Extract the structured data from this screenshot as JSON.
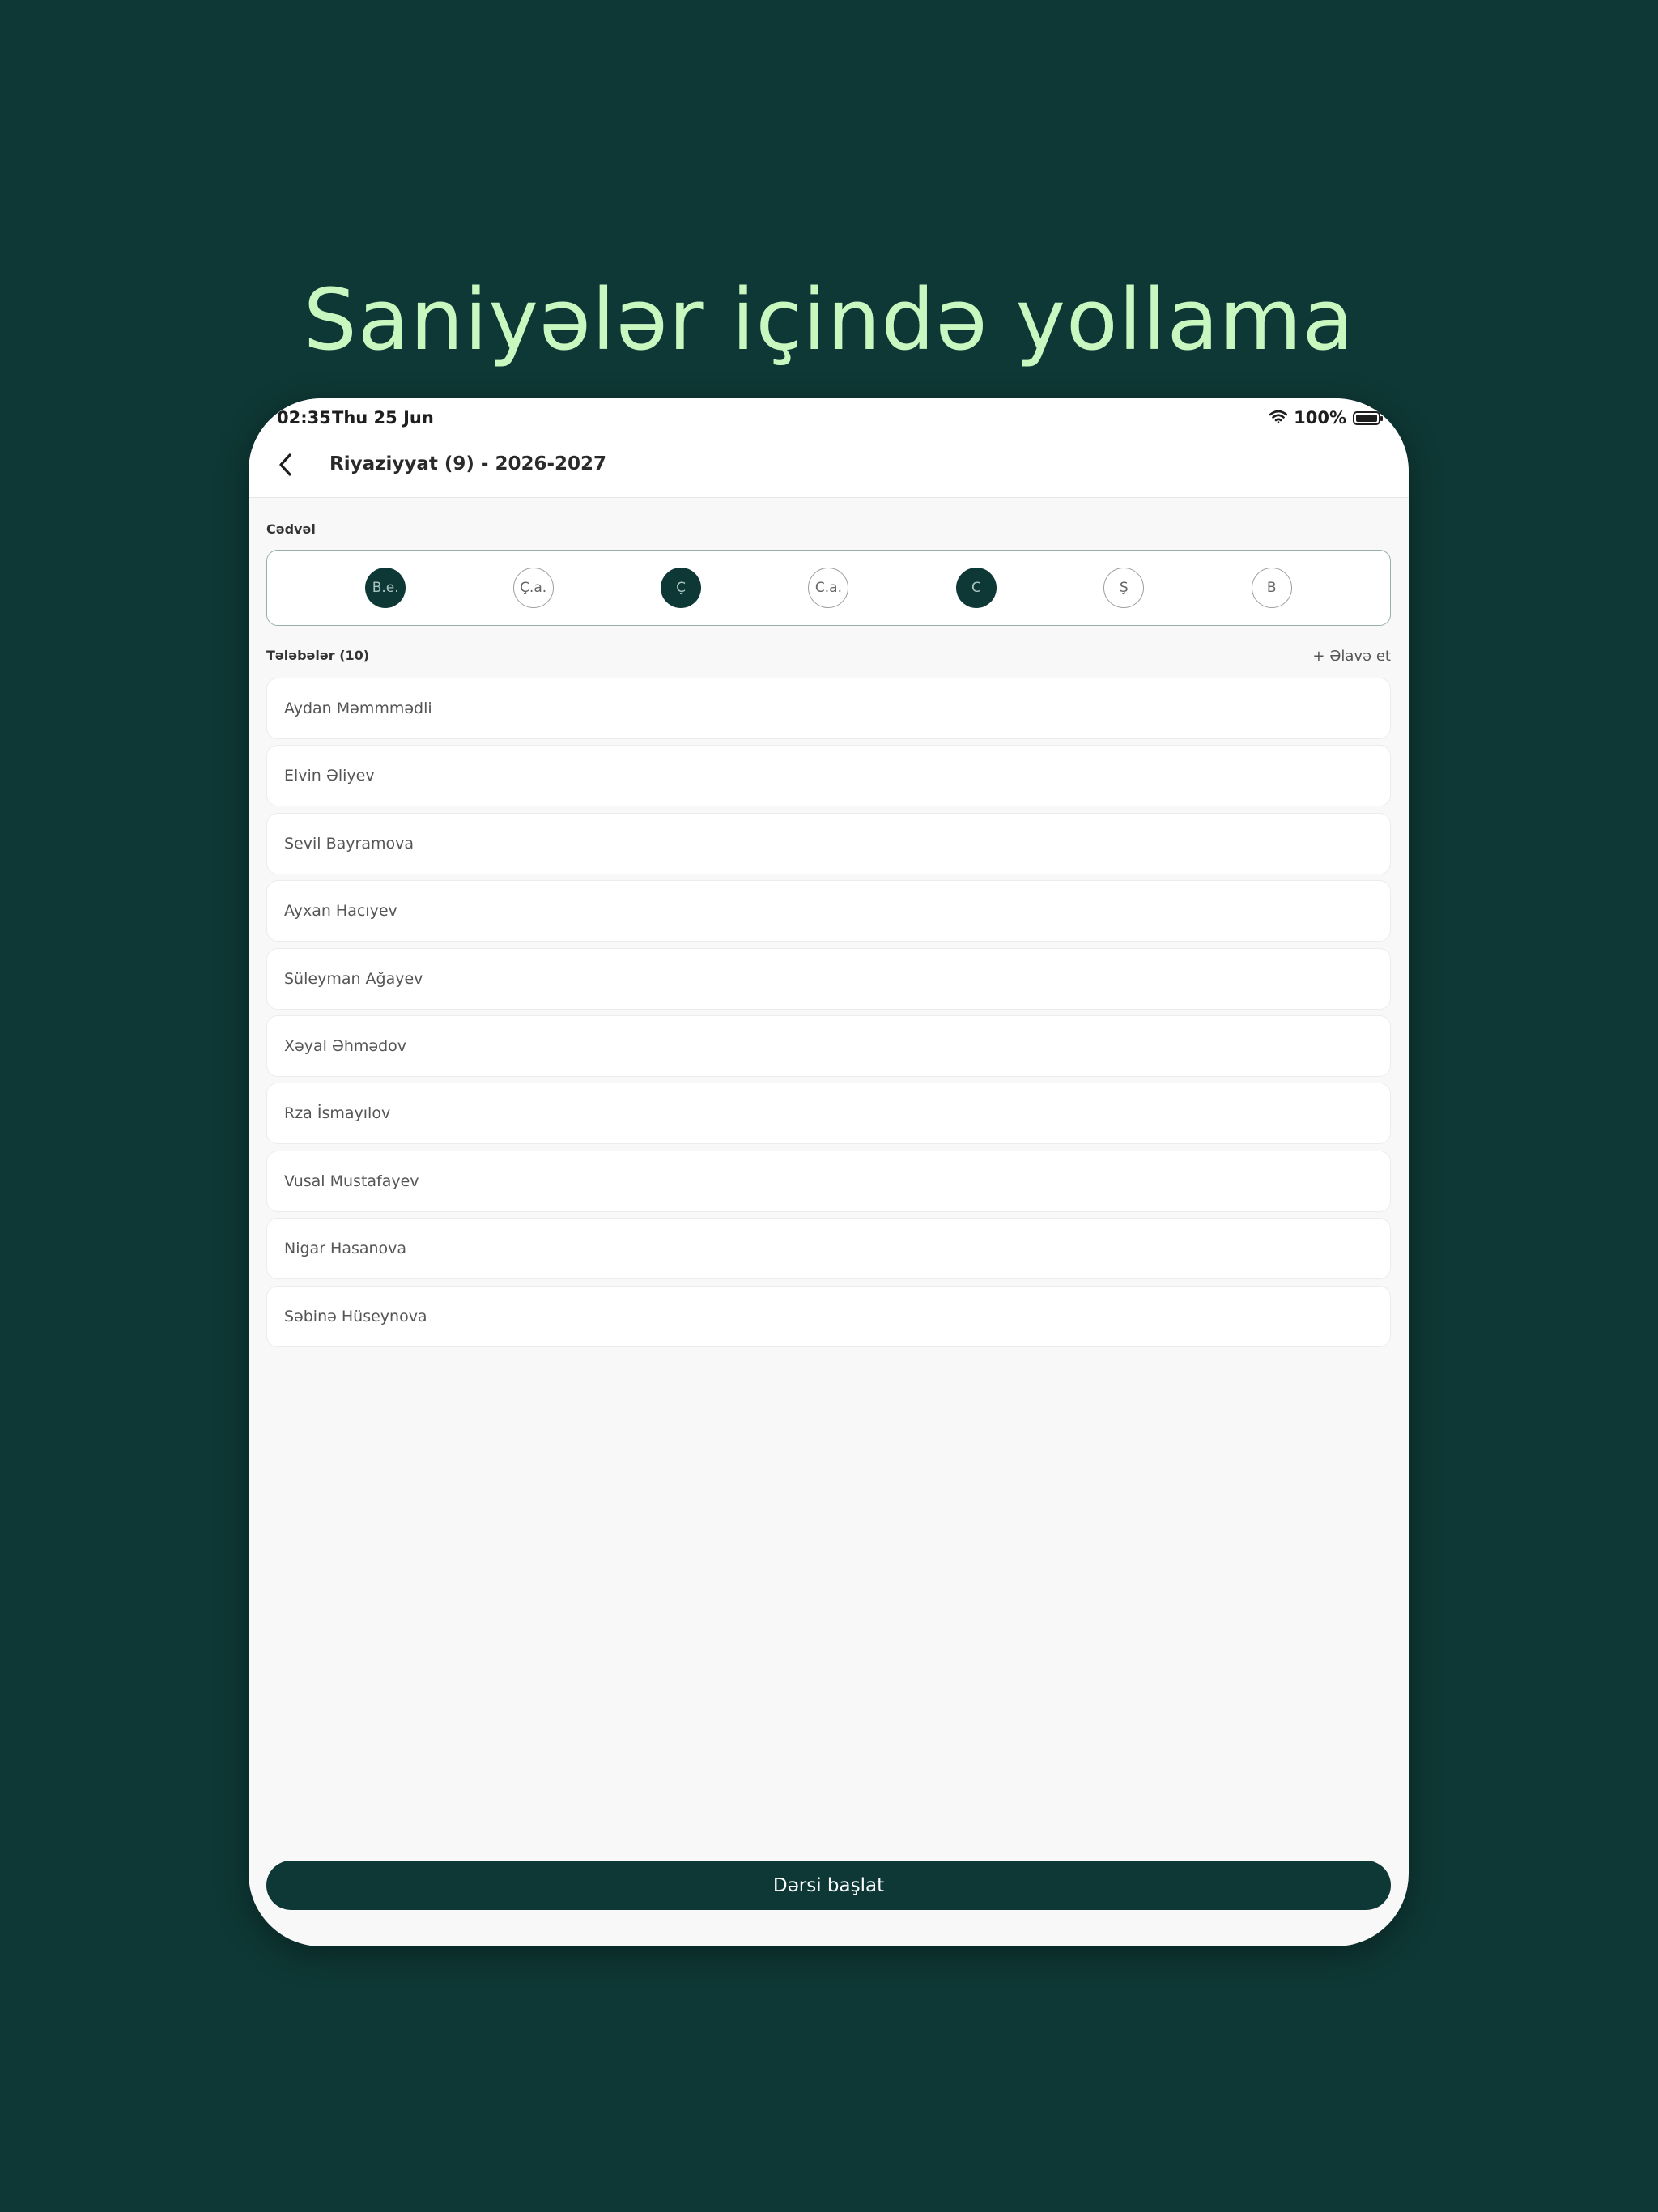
{
  "headline": "Saniyələr içində yollama",
  "status": {
    "time": "02:35",
    "date": "Thu 25 Jun",
    "battery": "100%"
  },
  "nav": {
    "title": "Riyaziyyat (9) - 2026-2027",
    "back_icon": "chevron-left-icon"
  },
  "schedule": {
    "label": "Cədvəl",
    "days": [
      {
        "label": "B.e.",
        "selected": true
      },
      {
        "label": "Ç.a.",
        "selected": false
      },
      {
        "label": "Ç",
        "selected": true
      },
      {
        "label": "C.a.",
        "selected": false
      },
      {
        "label": "C",
        "selected": true
      },
      {
        "label": "Ş",
        "selected": false
      },
      {
        "label": "B",
        "selected": false
      }
    ]
  },
  "students": {
    "label": "Tələbələr (10)",
    "add_label": "+ Əlavə et",
    "items": [
      "Aydan Məmmmədli",
      "Elvin Əliyev",
      "Sevil Bayramova",
      "Ayxan Hacıyev",
      "Süleyman Ağayev",
      "Xəyal Əhmədov",
      "Rza İsmayılov",
      "Vusal Mustafayev",
      "Nigar Hasanova",
      "Səbinə Hüseynova"
    ]
  },
  "start_button": "Dərsi başlat",
  "colors": {
    "background": "#0e3835",
    "headline": "#c9f7c0",
    "accent": "#0e3835"
  }
}
